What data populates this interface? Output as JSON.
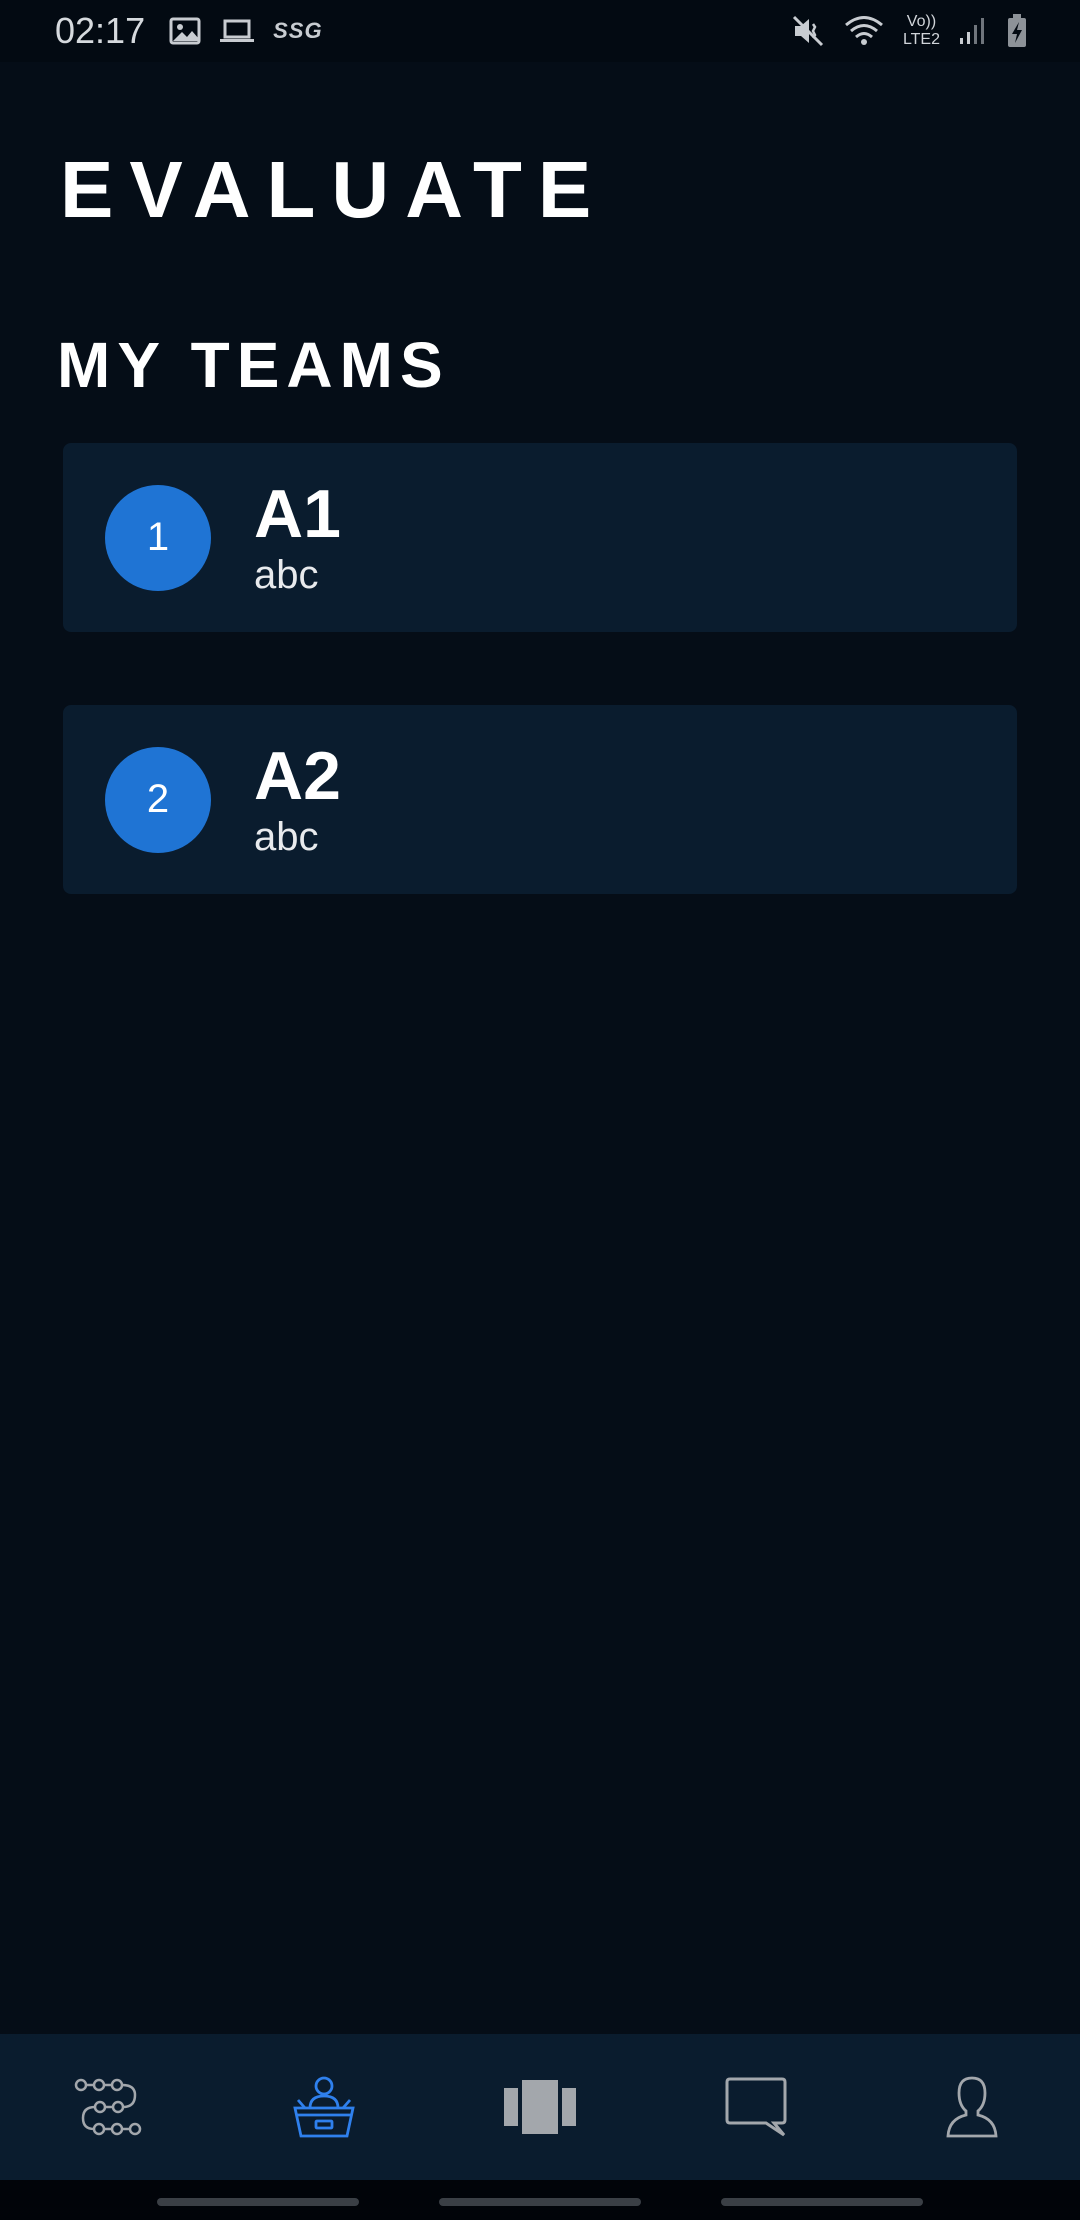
{
  "status_bar": {
    "time": "02:17",
    "carrier_tag": "SSG",
    "volte_label": "Vo))",
    "network_label": "LTE2",
    "icons": [
      "gallery-icon",
      "laptop-icon",
      "mute-icon",
      "wifi-icon",
      "signal-icon",
      "battery-charging-icon"
    ]
  },
  "page": {
    "title": "EVALUATE",
    "section_title": "MY TEAMS"
  },
  "teams": [
    {
      "number": "1",
      "name": "A1",
      "description": "abc"
    },
    {
      "number": "2",
      "name": "A2",
      "description": "abc"
    }
  ],
  "bottom_nav": {
    "items": [
      {
        "icon": "timeline-icon",
        "active": false
      },
      {
        "icon": "evaluate-presenter-icon",
        "active": true
      },
      {
        "icon": "cards-icon",
        "active": false
      },
      {
        "icon": "chat-icon",
        "active": false
      },
      {
        "icon": "profile-icon",
        "active": false
      }
    ]
  },
  "colors": {
    "background": "#050d17",
    "card": "#0a1c2e",
    "accent": "#1f74d4",
    "nav_active": "#2f80ed",
    "nav_inactive": "#a3a7ac"
  }
}
